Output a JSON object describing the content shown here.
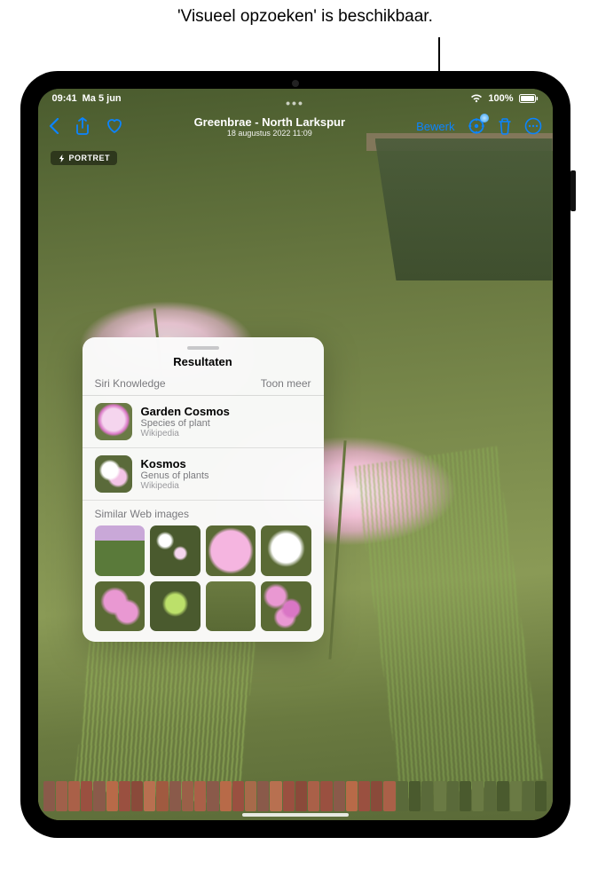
{
  "callout": "'Visueel opzoeken' is beschikbaar.",
  "status": {
    "time": "09:41",
    "date": "Ma 5 jun",
    "battery": "100%"
  },
  "toolbar": {
    "title": "Greenbrae - North Larkspur",
    "subtitle": "18 augustus 2022 11:09",
    "edit_label": "Bewerk"
  },
  "badge": {
    "portrait": "PORTRET"
  },
  "results": {
    "title": "Resultaten",
    "section_label": "Siri Knowledge",
    "show_more": "Toon meer",
    "items": [
      {
        "title": "Garden Cosmos",
        "subtitle": "Species of plant",
        "source": "Wikipedia"
      },
      {
        "title": "Kosmos",
        "subtitle": "Genus of plants",
        "source": "Wikipedia"
      }
    ],
    "similar_label": "Similar Web images"
  },
  "icons": {
    "back": "back-icon",
    "share": "share-icon",
    "favorite": "favorite-icon",
    "visual_lookup": "visual-lookup-icon",
    "trash": "trash-icon",
    "more": "more-icon",
    "wifi": "wifi-icon",
    "battery": "battery-icon",
    "bolt": "bolt-icon"
  },
  "filmstrip_colors": [
    "#8a5a4a",
    "#a0604a",
    "#aa6048",
    "#9a5040",
    "#8a5a4a",
    "#b86a48",
    "#9a5040",
    "#8a4a3a",
    "#b87050",
    "#a05a40",
    "#8a5a4a",
    "#9a6048",
    "#aa6048",
    "#8a5a4a",
    "#b86a48",
    "#9a5040",
    "#a76a4a",
    "#8a5a4a",
    "#b87050",
    "#9a5040",
    "#8a4a3a",
    "#aa6048",
    "#9a5040",
    "#8a5a4a",
    "#b86a48",
    "#9a5040",
    "#8a4a3a",
    "#aa6048",
    "#5a6a3a",
    "#4a5a2e",
    "#5a6a3a",
    "#6a7a44",
    "#5a6a3a",
    "#4a5a2e",
    "#6a7a44",
    "#5a6a3a",
    "#4a5a2e",
    "#6a7a44",
    "#5a6a3a",
    "#4a5a2e"
  ]
}
